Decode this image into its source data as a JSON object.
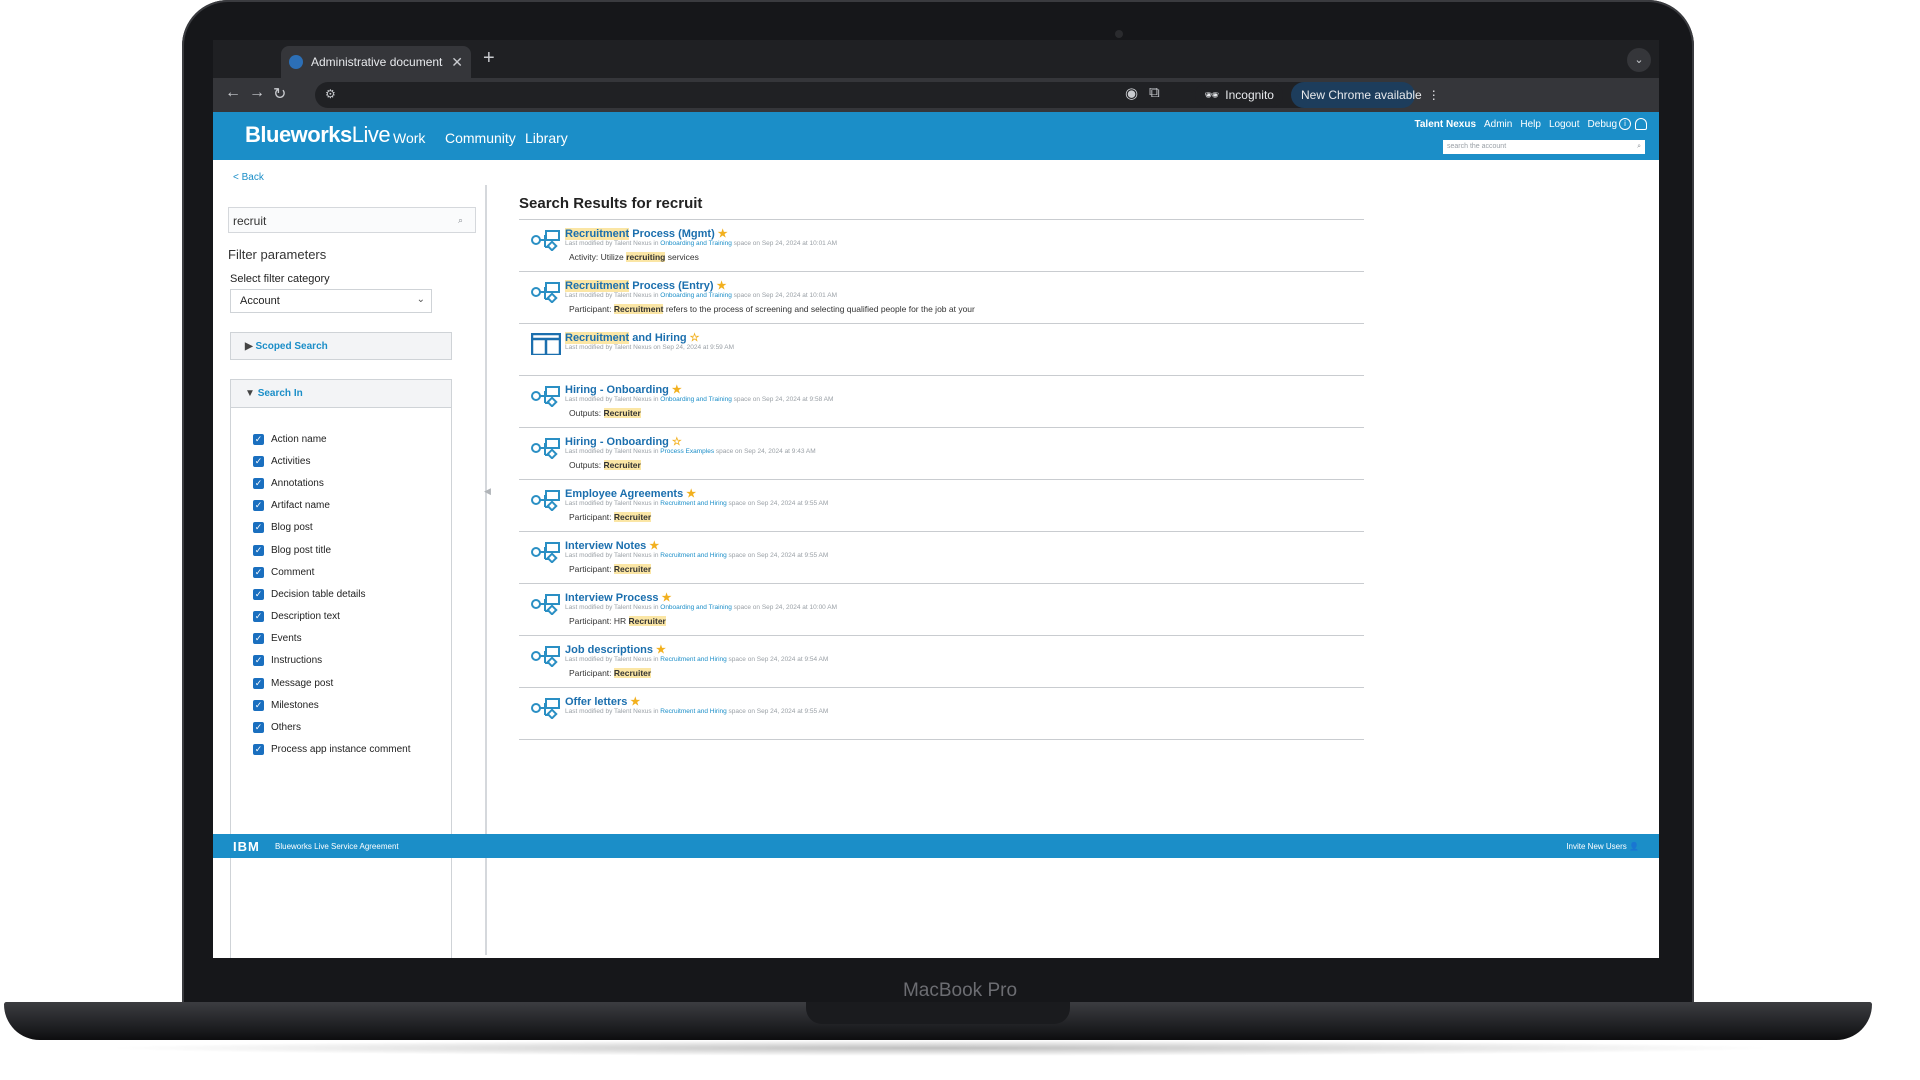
{
  "device": {
    "label": "MacBook Pro"
  },
  "browser": {
    "tab_title": "Administrative documents - B",
    "incognito_label": "Incognito",
    "update_label": "New Chrome available"
  },
  "app": {
    "logo_bold": "Blueworks",
    "logo_rest": "Live",
    "nav": [
      "Work",
      "Community",
      "Library"
    ],
    "user_links": [
      "Talent Nexus",
      "Admin",
      "Help",
      "Logout",
      "Debug"
    ],
    "search_placeholder": "search the account",
    "back_label": "< Back"
  },
  "sidebar": {
    "search_value": "recruit",
    "filter_title": "Filter parameters",
    "filter_label": "Select filter category",
    "filter_value": "Account",
    "scoped_label": "Scoped Search",
    "search_in_label": "Search In",
    "checkboxes": [
      "Action name",
      "Activities",
      "Annotations",
      "Artifact name",
      "Blog post",
      "Blog post title",
      "Comment",
      "Decision table details",
      "Description text",
      "Events",
      "Instructions",
      "Message post",
      "Milestones",
      "Others",
      "Process app instance comment"
    ]
  },
  "results": {
    "title": "Search Results for recruit",
    "items": [
      {
        "hl": "Recruitment",
        "rest": " Process (Mgmt)",
        "star": "filled",
        "icon": "process",
        "meta_pre": "Last modified by Talent Nexus in ",
        "space": "Onboarding and Training",
        "meta_post": " space on Sep 24, 2024 at 10:01 AM",
        "snip_pre": "Activity: Utilize ",
        "snip_hl": "recruiting",
        "snip_post": " services"
      },
      {
        "hl": "Recruitment",
        "rest": " Process (Entry)",
        "star": "filled",
        "icon": "process",
        "meta_pre": "Last modified by Talent Nexus in ",
        "space": "Onboarding and Training",
        "meta_post": " space on Sep 24, 2024 at 10:01 AM",
        "snip_pre": "Participant: ",
        "snip_hl": "Recruitment",
        "snip_post": " refers to the process of screening and selecting qualified people for the job at your"
      },
      {
        "hl": "Recruitment",
        "rest": " and Hiring",
        "star": "empty",
        "icon": "space",
        "meta_pre": "Last modified by Talent Nexus on Sep 24, 2024 at 9:59 AM",
        "space": "",
        "meta_post": "",
        "snip_pre": "",
        "snip_hl": "",
        "snip_post": ""
      },
      {
        "hl": "",
        "rest": "Hiring - Onboarding",
        "star": "filled",
        "icon": "process",
        "meta_pre": "Last modified by Talent Nexus in ",
        "space": "Onboarding and Training",
        "meta_post": " space on Sep 24, 2024 at 9:58 AM",
        "snip_pre": "Outputs: ",
        "snip_hl": "Recruiter",
        "snip_post": ""
      },
      {
        "hl": "",
        "rest": "Hiring - Onboarding",
        "star": "empty",
        "icon": "process",
        "meta_pre": "Last modified by Talent Nexus in ",
        "space": "Process Examples",
        "meta_post": " space on Sep 24, 2024 at 9:43 AM",
        "snip_pre": "Outputs: ",
        "snip_hl": "Recruiter",
        "snip_post": ""
      },
      {
        "hl": "",
        "rest": "Employee Agreements",
        "star": "filled",
        "icon": "process",
        "meta_pre": "Last modified by Talent Nexus in ",
        "space": "Recruitment and Hiring",
        "meta_post": " space on Sep 24, 2024 at 9:55 AM",
        "snip_pre": "Participant: ",
        "snip_hl": "Recruiter",
        "snip_post": ""
      },
      {
        "hl": "",
        "rest": "Interview Notes",
        "star": "filled",
        "icon": "process",
        "meta_pre": "Last modified by Talent Nexus in ",
        "space": "Recruitment and Hiring",
        "meta_post": " space on Sep 24, 2024 at 9:55 AM",
        "snip_pre": "Participant: ",
        "snip_hl": "Recruiter",
        "snip_post": ""
      },
      {
        "hl": "",
        "rest": "Interview Process",
        "star": "filled",
        "icon": "process",
        "meta_pre": "Last modified by Talent Nexus in ",
        "space": "Onboarding and Training",
        "meta_post": " space on Sep 24, 2024 at 10:00 AM",
        "snip_pre": "Participant: HR ",
        "snip_hl": "Recruiter",
        "snip_post": ""
      },
      {
        "hl": "",
        "rest": "Job descriptions",
        "star": "filled",
        "icon": "process",
        "meta_pre": "Last modified by Talent Nexus in ",
        "space": "Recruitment and Hiring",
        "meta_post": " space on Sep 24, 2024 at 9:54 AM",
        "snip_pre": "Participant: ",
        "snip_hl": "Recruiter",
        "snip_post": ""
      },
      {
        "hl": "",
        "rest": "Offer letters",
        "star": "filled",
        "icon": "process",
        "meta_pre": "Last modified by Talent Nexus in ",
        "space": "Recruitment and Hiring",
        "meta_post": " space on Sep 24, 2024 at 9:55 AM",
        "snip_pre": "",
        "snip_hl": "",
        "snip_post": ""
      }
    ]
  },
  "footer": {
    "ibm": "IBM",
    "agreement": "Blueworks Live Service Agreement",
    "invite": "Invite New Users"
  },
  "colors": {
    "brand": "#1b8ec8",
    "highlight": "#fbe6a5",
    "star": "#f2b01e",
    "checkbox": "#1a6fbf"
  }
}
